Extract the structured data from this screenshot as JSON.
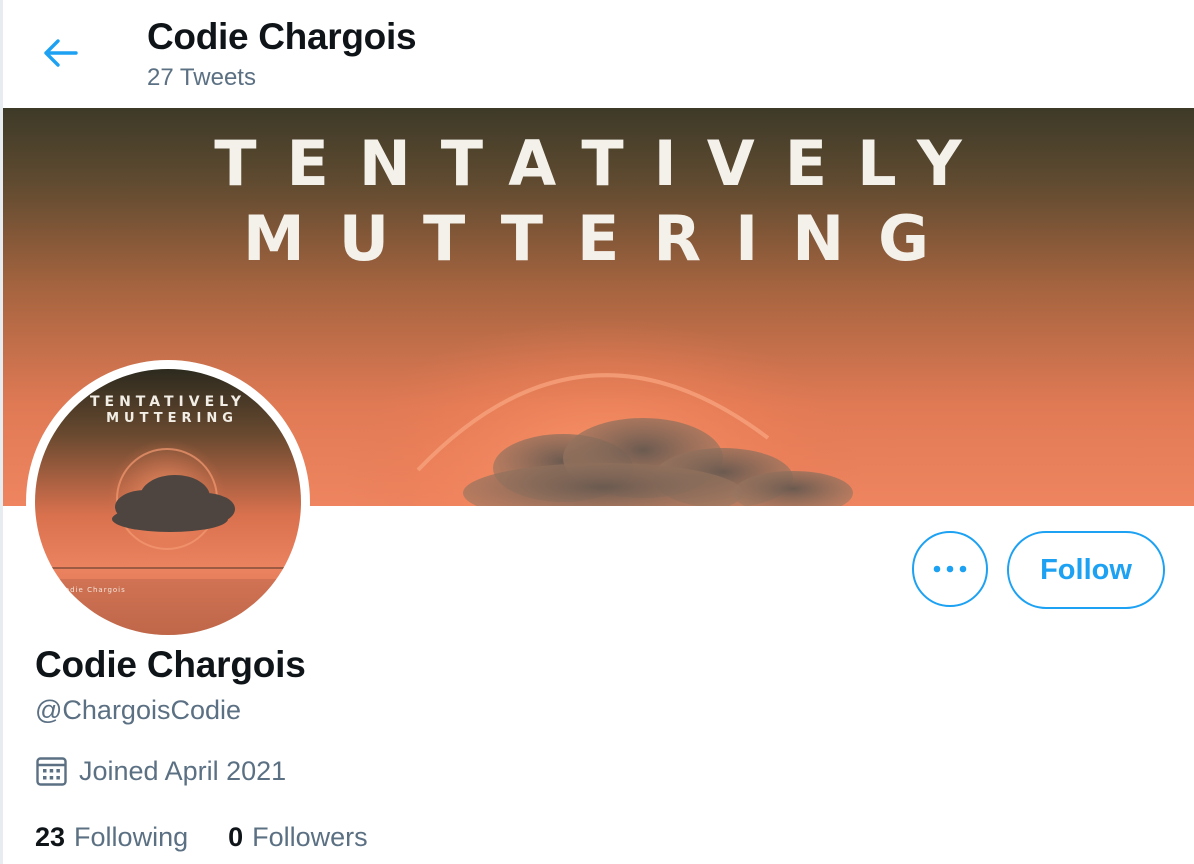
{
  "header": {
    "title": "Codie Chargois",
    "tweet_count": "27 Tweets"
  },
  "banner": {
    "line1": "TENTATIVELY",
    "line2": "MUTTERING"
  },
  "avatar": {
    "line1": "TENTATIVELY",
    "line2": "MUTTERING",
    "caption": "Codie Chargois"
  },
  "actions": {
    "more_icon": "more-dots-icon",
    "follow_label": "Follow"
  },
  "profile": {
    "name": "Codie Chargois",
    "handle": "@ChargoisCodie",
    "joined": "Joined April 2021",
    "following_count": "23",
    "following_label": "Following",
    "followers_count": "0",
    "followers_label": "Followers"
  },
  "colors": {
    "accent": "#1da1f2",
    "secondary_text": "#5b7083",
    "primary_text": "#0f1419"
  }
}
